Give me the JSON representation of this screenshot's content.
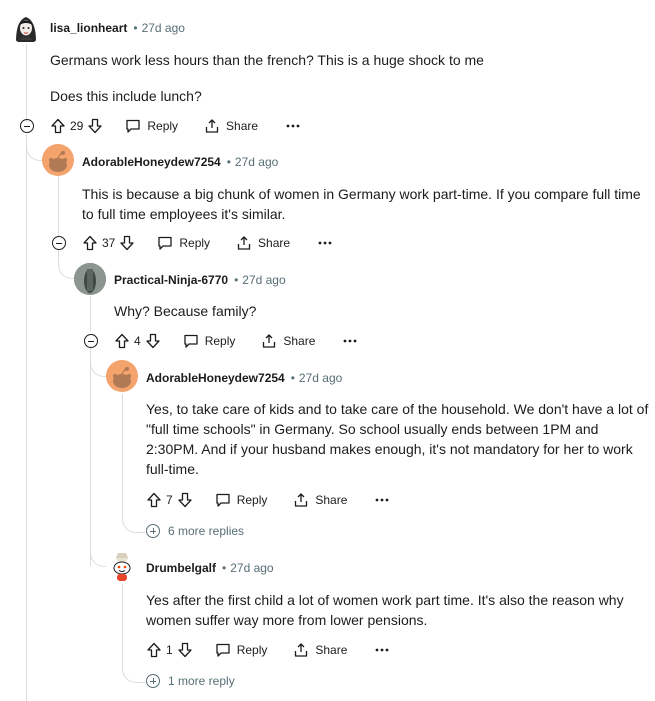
{
  "comments": [
    {
      "author": "lisa_lionheart",
      "time": "27d ago",
      "paragraphs": [
        "Germans work less hours than the french? This is a huge shock to me",
        "Does this include lunch?"
      ],
      "votes": "29",
      "reply": "Reply",
      "share": "Share"
    },
    {
      "author": "AdorableHoneydew7254",
      "time": "27d ago",
      "paragraphs": [
        "This is because a big chunk of women in Germany work part-time. If you compare full time to full time employees it's similar."
      ],
      "votes": "37",
      "reply": "Reply",
      "share": "Share"
    },
    {
      "author": "Practical-Ninja-6770",
      "time": "27d ago",
      "paragraphs": [
        "Why? Because family?"
      ],
      "votes": "4",
      "reply": "Reply",
      "share": "Share"
    },
    {
      "author": "AdorableHoneydew7254",
      "time": "27d ago",
      "paragraphs": [
        "Yes, to take care of kids and to take care of the household. We don't have a lot of \"full time schools\" in Germany. So school usually ends between 1PM and 2:30PM. And if your husband makes enough, it's not mandatory for her to work full-time."
      ],
      "votes": "7",
      "reply": "Reply",
      "share": "Share",
      "more_replies": "6 more replies"
    },
    {
      "author": "Drumbelgalf",
      "time": "27d ago",
      "paragraphs": [
        "Yes after the first child a lot of women work part time. It's also the reason why women suffer way more from lower pensions."
      ],
      "votes": "1",
      "reply": "Reply",
      "share": "Share",
      "more_replies": "1 more reply"
    }
  ],
  "colors": {
    "text": "#1c1c1c",
    "meta": "#576f76",
    "thread": "#dadde0",
    "honeydew_avatar": "#f4a36c"
  },
  "icons": [
    "upvote-icon",
    "downvote-icon",
    "reply-icon",
    "share-icon",
    "overflow-icon",
    "collapse-icon",
    "expand-icon",
    "snoo-avatar-icon"
  ]
}
